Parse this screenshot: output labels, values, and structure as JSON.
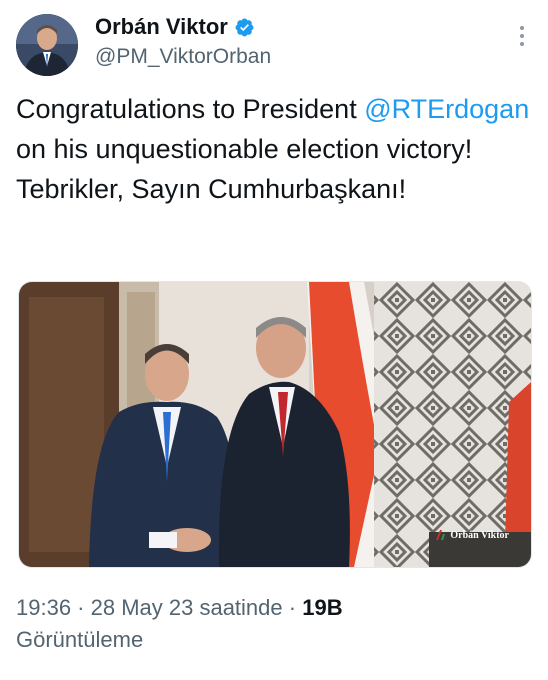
{
  "author": {
    "display_name": "Orbán Viktor",
    "handle": "@PM_ViktorOrban",
    "verified": true
  },
  "tweet": {
    "text_before": "Congratulations to President ",
    "mention": "@RTErdogan",
    "text_after": " on his unquestionable election victory! Tebrikler, Sayın Cumhurbaşkanı!"
  },
  "media": {
    "watermark": "Orbán Viktor",
    "description_icon": "photo"
  },
  "meta": {
    "time": "19:36",
    "date": "28 May 23 saatinde",
    "views_count": "19B",
    "views_label": "Görüntüleme"
  },
  "colors": {
    "link": "#1d9bf0",
    "verified": "#1d9bf0",
    "secondary_text": "#536471"
  }
}
